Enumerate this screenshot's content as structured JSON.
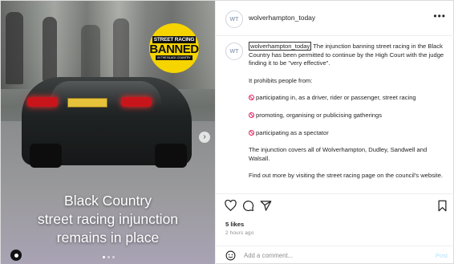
{
  "post": {
    "username": "wolverhampton_today",
    "avatar_text": "WT",
    "more_icon": "more-horizontal-icon"
  },
  "media": {
    "badge": {
      "line1": "STREET RACING",
      "line2": "BANNED",
      "line3": "IN THE BLACK COUNTRY"
    },
    "plate_text": "",
    "caption": [
      "Black Country",
      "street racing injunction",
      "remains in place"
    ],
    "carousel": {
      "count": 3,
      "active": 1
    }
  },
  "caption": {
    "username": "wolverhampton_today",
    "intro": "The injunction banning street racing in the Black Country has been permitted to continue by the High Court with the judge finding it to be \"very effective\".",
    "prohibits": "It prohibits people from:",
    "items": [
      "participating in, as a driver, rider or passenger, street racing",
      "promoting, organising or publicising gatherings",
      "participating as a spectator"
    ],
    "coverage": "The injunction covers all of Wolverhampton, Dudley, Sandwell and Walsall.",
    "more": "Find out more by visiting the street racing page on the council's website."
  },
  "actions": {
    "likes": "5 likes",
    "time": "2 hours ago"
  },
  "comment_box": {
    "placeholder": "Add a comment...",
    "post_label": "Post"
  },
  "colors": {
    "accent": "#0095f6",
    "post_disabled": "#b2dffc",
    "prohibit_icon": "#e0245e",
    "badge_yellow": "#f5d400"
  }
}
